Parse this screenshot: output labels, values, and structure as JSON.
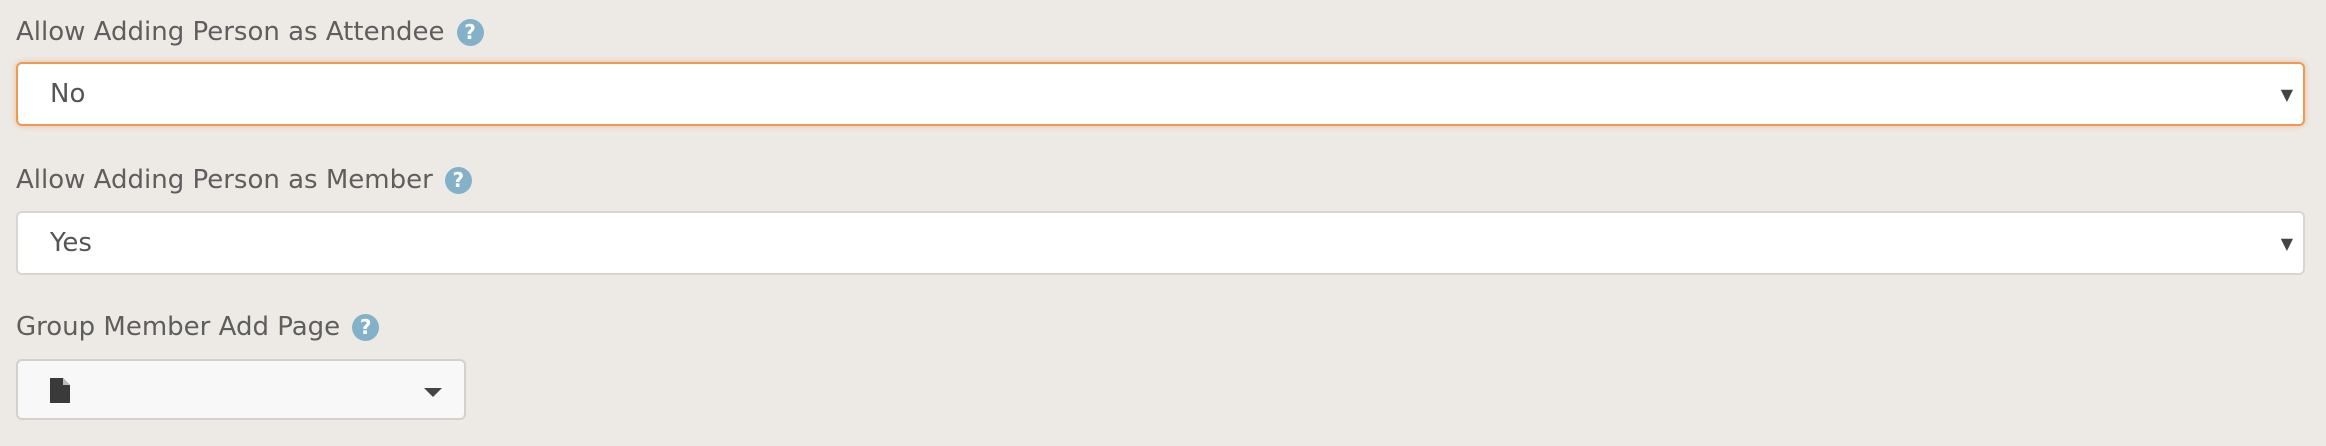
{
  "fields": [
    {
      "label": "Allow Adding Person as Attendee",
      "help_icon": "question-circle-icon",
      "value": "No",
      "focused": true
    },
    {
      "label": "Allow Adding Person as Member",
      "help_icon": "question-circle-icon",
      "value": "Yes",
      "focused": false
    },
    {
      "label": "Group Member Add Page",
      "help_icon": "question-circle-icon",
      "picker_icon": "file-icon",
      "value": ""
    }
  ],
  "icons": {
    "help_glyph": "?",
    "select_caret_glyph": "▼"
  },
  "colors": {
    "background": "#edeae5",
    "focus_border": "#ee9a57",
    "help_icon": "#83b1c9",
    "label_text": "#5e5e5e"
  }
}
